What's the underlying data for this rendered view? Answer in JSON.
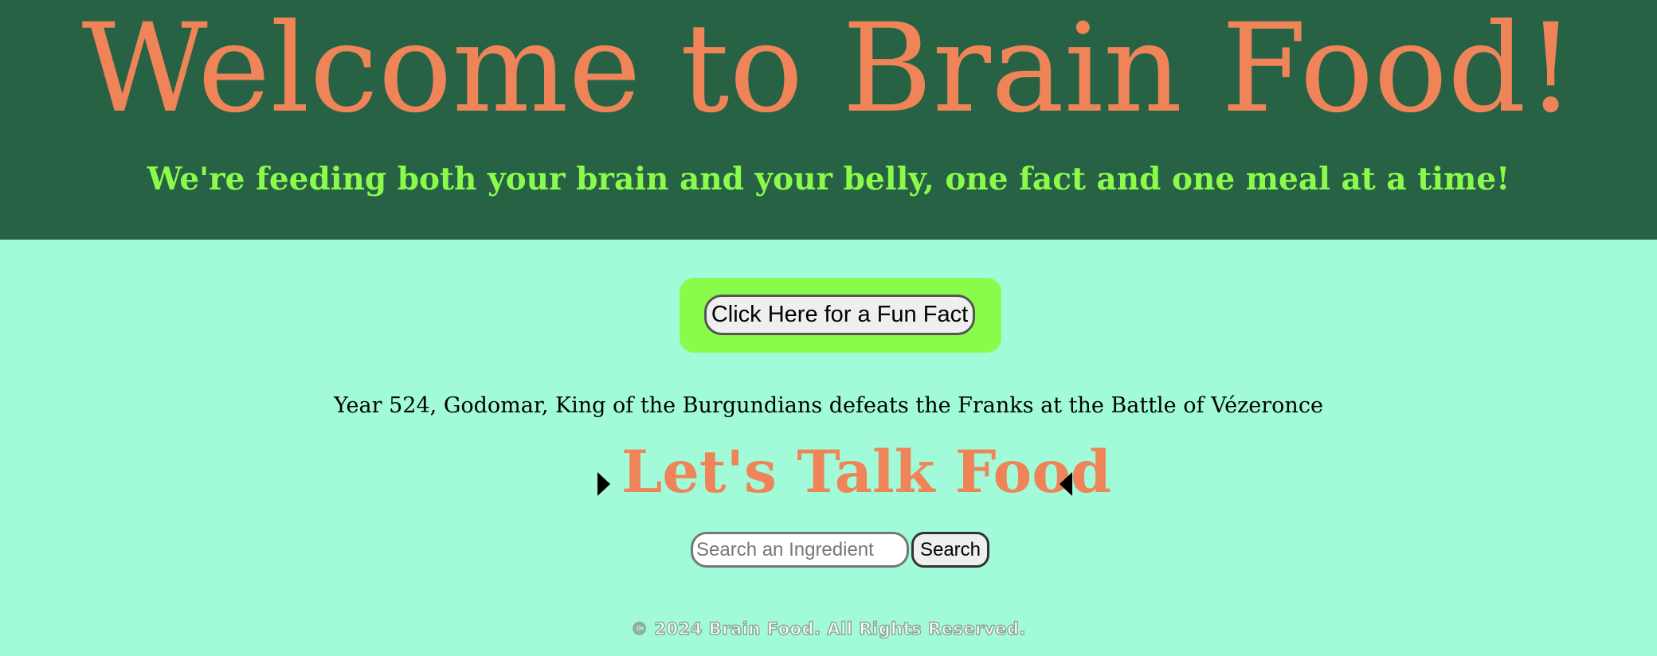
{
  "header": {
    "title": "Welcome to Brain Food!",
    "tagline": "We're feeding both your brain and your belly, one fact and one meal at a time!"
  },
  "fun_fact": {
    "button_label": "Click Here for a Fun Fact",
    "fact_text": "Year 524, Godomar, King of the Burgundians defeats the Franks at the Battle of Vézeronce"
  },
  "food_section": {
    "heading": "Let's Talk Food",
    "search_placeholder": "Search an Ingredient",
    "search_value": "",
    "search_button_label": "Search"
  },
  "footer": {
    "copyright": "© 2024 Brain Food. All Rights Reserved."
  },
  "colors": {
    "header_bg": "#276244",
    "page_bg": "#a1fbd9",
    "accent_orange": "#ee8458",
    "accent_green": "#8bfb4b"
  },
  "icons": {
    "left_marker": "caret-right-icon",
    "right_marker": "caret-left-icon"
  }
}
